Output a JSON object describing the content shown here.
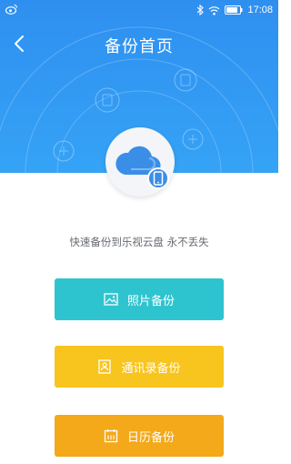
{
  "status_bar": {
    "time": "17:08",
    "icons": [
      "weibo-icon",
      "bluetooth-icon",
      "wifi-icon",
      "battery-icon"
    ]
  },
  "header": {
    "title": "备份首页",
    "back_icon": "chevron-left-icon"
  },
  "hero": {
    "illustration_icon": "cloud-phone-icon"
  },
  "tagline": "快速备份到乐视云盘 永不丢失",
  "actions": [
    {
      "label": "照片备份",
      "icon": "image-icon",
      "color": "#2ec4cf"
    },
    {
      "label": "通讯录备份",
      "icon": "contacts-icon",
      "color": "#f8c41e"
    },
    {
      "label": "日历备份",
      "icon": "calendar-icon",
      "color": "#f3a91a"
    }
  ],
  "colors": {
    "header_blue": "#2f8ff0",
    "cloud_blue": "#3a8ee8"
  }
}
